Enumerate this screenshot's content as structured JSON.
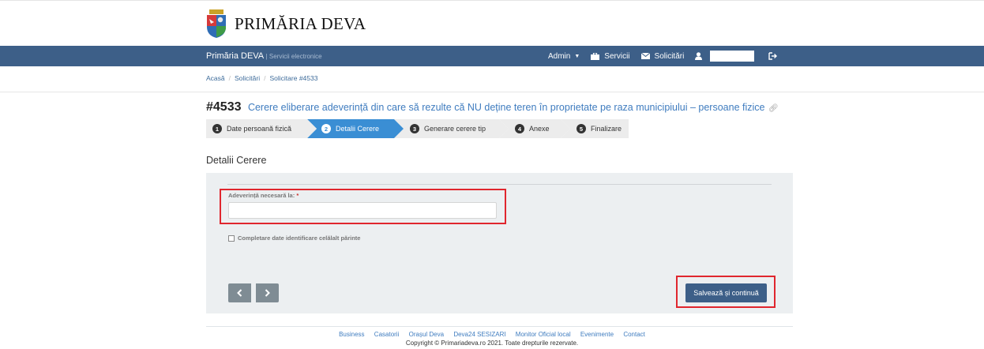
{
  "header": {
    "site_title": "PRIMĂRIA DEVA"
  },
  "navbar": {
    "brand": "Primăria DEVA",
    "brand_sub": "| Servicii electronice",
    "admin_label": "Admin",
    "servicii_label": "Servicii",
    "solicitari_label": "Solicitări"
  },
  "breadcrumb": {
    "home": "Acasă",
    "solicitari": "Solicitări",
    "current": "Solicitare #4533"
  },
  "request": {
    "id": "#4533",
    "title": "Cerere eliberare adeverință din care să rezulte că NU deține teren în proprietate pe raza municipiului – persoane fizice"
  },
  "wizard": {
    "steps": [
      {
        "num": "1",
        "label": "Date persoană fizică"
      },
      {
        "num": "2",
        "label": "Detalii Cerere"
      },
      {
        "num": "3",
        "label": "Generare cerere tip"
      },
      {
        "num": "4",
        "label": "Anexe"
      },
      {
        "num": "5",
        "label": "Finalizare"
      }
    ],
    "active_step": 2
  },
  "form": {
    "section_title": "Detalii Cerere",
    "field_label": "Adeverință necesară la:",
    "field_required_mark": "*",
    "field_value": "",
    "checkbox_label": "Completare date identificare celălalt părinte",
    "checkbox_checked": false,
    "save_label": "Salvează și continuă"
  },
  "footer": {
    "links": [
      "Business",
      "Casatorii",
      "Orașul Deva",
      "Deva24 SESIZARI",
      "Monitor Oficial local",
      "Evenimente",
      "Contact"
    ],
    "copyright": "Copyright © Primariadeva.ro 2021. Toate drepturile rezervate."
  },
  "colors": {
    "navbar": "#3d5f88",
    "active_step": "#3a8ed4",
    "link": "#3f7cbf",
    "highlight": "#e0262e"
  }
}
